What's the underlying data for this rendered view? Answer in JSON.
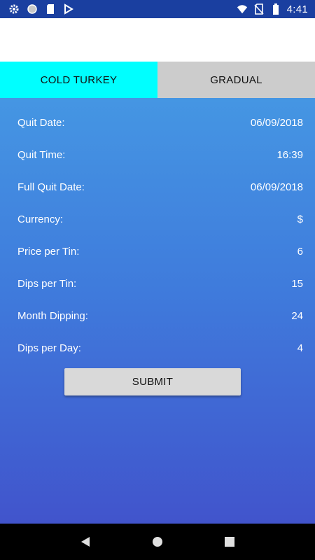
{
  "status_bar": {
    "time": "4:41",
    "left_icons": [
      "gear-icon",
      "circle-icon",
      "sd-card-icon",
      "download-check-icon"
    ],
    "right_icons": [
      "wifi-icon",
      "no-sim-icon",
      "battery-icon"
    ]
  },
  "tabs": [
    {
      "label": "COLD TURKEY",
      "active": true
    },
    {
      "label": "GRADUAL",
      "active": false
    }
  ],
  "form": {
    "rows": [
      {
        "label": "Quit Date:",
        "value": "06/09/2018"
      },
      {
        "label": "Quit Time:",
        "value": "16:39"
      },
      {
        "label": "Full Quit Date:",
        "value": "06/09/2018"
      },
      {
        "label": "Currency:",
        "value": "$"
      },
      {
        "label": "Price per Tin:",
        "value": "6"
      },
      {
        "label": "Dips per Tin:",
        "value": "15"
      },
      {
        "label": "Month Dipping:",
        "value": "24"
      },
      {
        "label": "Dips per Day:",
        "value": "4"
      }
    ],
    "submit_label": "SUBMIT"
  },
  "colors": {
    "tab_active": "#00ffff",
    "tab_inactive": "#cccccc",
    "gradient_top": "#4596e3",
    "gradient_bottom": "#4154cc"
  },
  "nav_bar": {
    "buttons": [
      "back-icon",
      "home-icon",
      "recents-icon"
    ]
  }
}
